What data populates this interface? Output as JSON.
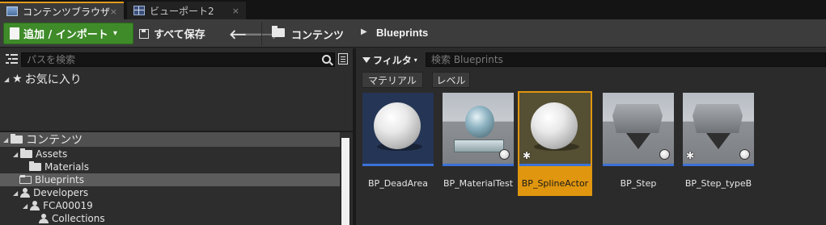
{
  "tabs": [
    {
      "label": "コンテンツブラウザ",
      "close": "×",
      "icon": "content-browser-icon"
    },
    {
      "label": "ビューポート2",
      "close": "×",
      "icon": "viewport-icon"
    }
  ],
  "toolbar": {
    "add_import_label": "追加 / インポート",
    "save_all_label": "すべて保存",
    "back_glyph": "🡐",
    "forward_glyph": "🡒"
  },
  "breadcrumb": {
    "root": "コンテンツ",
    "separator": "▶",
    "current": "Blueprints"
  },
  "sources": {
    "search_placeholder": "パスを検索",
    "favorites_label": "お気に入り",
    "tree": [
      {
        "label": "コンテンツ",
        "type": "folder",
        "expander": "◢",
        "root": true
      },
      {
        "label": "Assets",
        "type": "folder",
        "expander": "◢"
      },
      {
        "label": "Materials",
        "type": "folder",
        "expander": ""
      },
      {
        "label": "Blueprints",
        "type": "folder-outline",
        "expander": "",
        "selected": true
      },
      {
        "label": "Developers",
        "type": "person",
        "expander": "◢"
      },
      {
        "label": "FCA00019",
        "type": "person",
        "expander": "◢"
      },
      {
        "label": "Collections",
        "type": "person",
        "expander": ""
      }
    ]
  },
  "assets": {
    "filter_label": "フィルタ",
    "search_placeholder": "検索 Blueprints",
    "filter_chips": [
      "マテリアル",
      "レベル"
    ],
    "items": [
      {
        "name": "BP_DeadArea",
        "thumb": "white-sphere-blue-bg"
      },
      {
        "name": "BP_MaterialTest",
        "thumb": "glass-sphere-pedestal"
      },
      {
        "name": "BP_SplineActor",
        "thumb": "white-sphere-dark-bg",
        "selected": true
      },
      {
        "name": "BP_Step",
        "thumb": "hex-rock-cone"
      },
      {
        "name": "BP_Step_typeB",
        "thumb": "hex-rock-cone"
      }
    ]
  },
  "colors": {
    "accent_orange": "#e0960e",
    "add_button_green": "#3f8b2a",
    "asset_type_bar_blue": "#3b72d6"
  }
}
